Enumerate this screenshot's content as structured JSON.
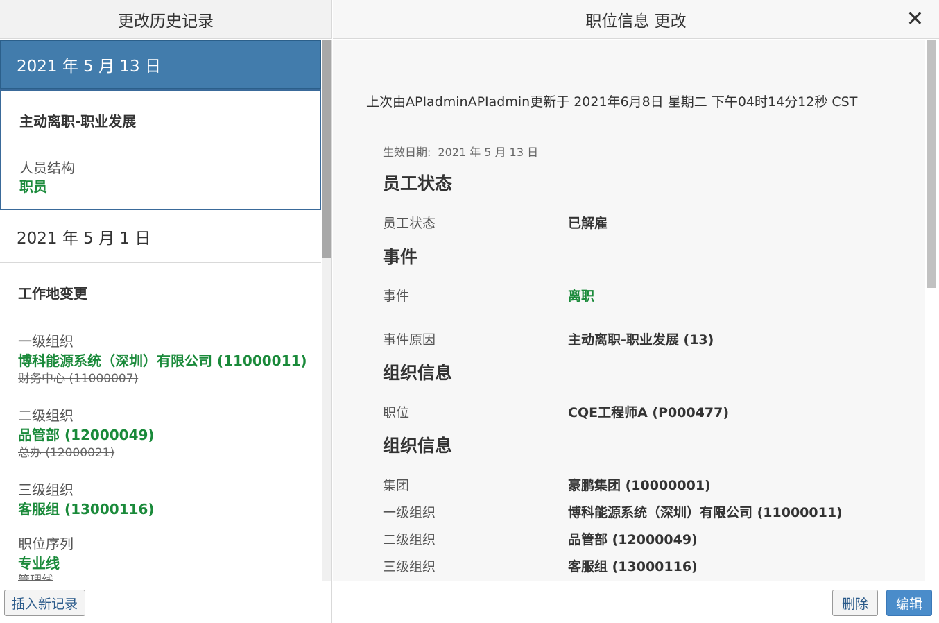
{
  "header": {
    "left_title": "更改历史记录",
    "right_title": "职位信息 更改",
    "close_symbol": "✕"
  },
  "history": {
    "selected_date": "2021 年 5 月 13 日",
    "selected_card": {
      "title": "主动离职-职业发展",
      "label": "人员结构",
      "value": "职员"
    },
    "second_date": "2021 年 5 月 1 日",
    "second_card": {
      "title": "工作地变更",
      "fields": [
        {
          "label": "一级组织",
          "new": "博科能源系统（深圳）有限公司 (11000011)",
          "old": "财务中心 (11000007)"
        },
        {
          "label": "二级组织",
          "new": "品管部 (12000049)",
          "old": "总办 (12000021)"
        },
        {
          "label": "三级组织",
          "new": "客服组 (13000116)"
        },
        {
          "label": "职位序列",
          "new": "专业线",
          "old": "管理线"
        }
      ]
    }
  },
  "detail": {
    "updated_line": "上次由APIadminAPIadmin更新于 2021年6月8日 星期二 下午04时14分12秒 CST",
    "effective_label": "生效日期:",
    "effective_value": "2021 年 5 月 13 日",
    "sections": [
      {
        "title": "员工状态",
        "fields": [
          {
            "label": "员工状态",
            "value": "已解雇"
          }
        ]
      },
      {
        "title": "事件",
        "fields": [
          {
            "label": "事件",
            "value": "离职"
          },
          {
            "label": "事件原因",
            "value": "主动离职-职业发展 (13)"
          }
        ]
      },
      {
        "title": "组织信息",
        "fields": [
          {
            "label": "职位",
            "value": "CQE工程师A (P000477)"
          }
        ]
      },
      {
        "title": "组织信息",
        "fields": [
          {
            "label": "集团",
            "value": "豪鹏集团 (10000001)"
          },
          {
            "label": "一级组织",
            "value": "博科能源系统（深圳）有限公司 (11000011)"
          },
          {
            "label": "二级组织",
            "value": "品管部 (12000049)"
          },
          {
            "label": "三级组织",
            "value": "客服组 (13000116)"
          }
        ]
      }
    ]
  },
  "footer": {
    "insert_label": "插入新记录",
    "delete_label": "删除",
    "edit_label": "编辑"
  },
  "colors": {
    "selected_bg": "#427cac",
    "green_value": "#1a8a3a",
    "edit_button": "#4a8cca"
  }
}
